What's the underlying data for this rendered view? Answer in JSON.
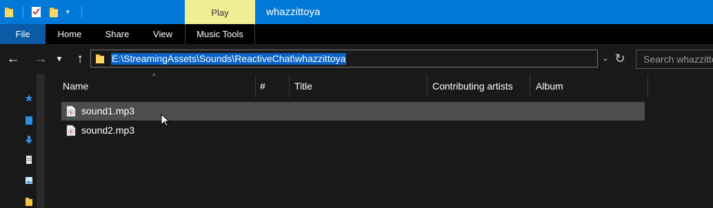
{
  "titlebar": {
    "context_tab": "Play",
    "window_title": "whazzittoya",
    "quick_access": [
      "folder-icon",
      "properties-check-icon",
      "new-folder-icon",
      "customize-dropdown"
    ]
  },
  "ribbon": {
    "tabs": [
      "File",
      "Home",
      "Share",
      "View",
      "Music Tools"
    ],
    "active_color": "#0b5aa6"
  },
  "address": {
    "path": "E:\\StreamingAssets\\Sounds\\ReactiveChat\\whazzittoya"
  },
  "search": {
    "placeholder": "Search whazzittoya"
  },
  "columns": [
    "Name",
    "#",
    "Title",
    "Contributing artists",
    "Album"
  ],
  "files": [
    {
      "name": "sound1.mp3",
      "icon": "mp3-file-icon",
      "selected": true
    },
    {
      "name": "sound2.mp3",
      "icon": "mp3-file-icon",
      "selected": false
    }
  ],
  "colors": {
    "titlebar": "#0078d7",
    "context_tab": "#f2ee96",
    "selection_highlight": "#0a63c7",
    "row_hover": "#4d4d4d"
  }
}
